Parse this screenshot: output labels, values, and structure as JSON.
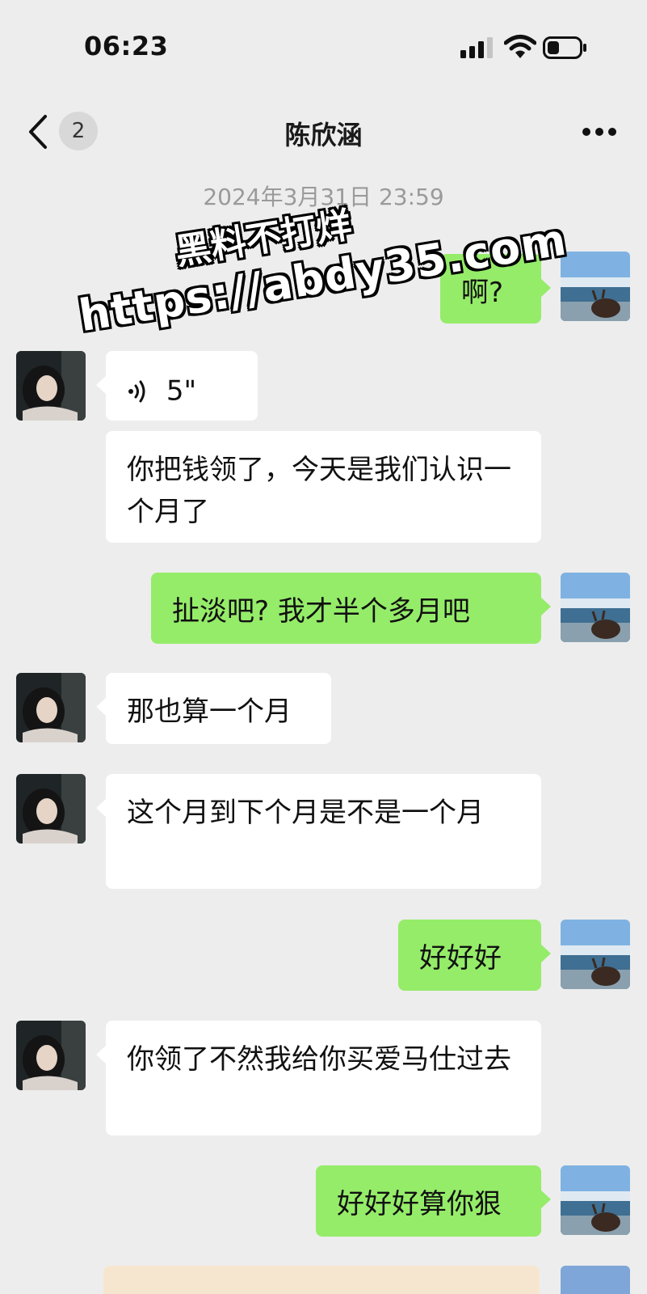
{
  "status_bar": {
    "time": "06:23",
    "signal_icon": "cellular-signal-icon",
    "wifi_icon": "wifi-icon",
    "battery_icon": "battery-icon"
  },
  "header": {
    "back_icon": "chevron-left-icon",
    "unread_count": "2",
    "title": "陈欣涵",
    "more_icon": "more-horizontal-icon"
  },
  "timestamp": "2024年3月31日 23:59",
  "watermark": {
    "line1": "黑料不打烊",
    "line2": "https://abdy35.com"
  },
  "messages": [
    {
      "side": "out",
      "text": "啊?"
    },
    {
      "side": "in",
      "type": "voice",
      "duration": "5\"",
      "icon": "voice-wave-icon"
    },
    {
      "side": "in",
      "text": "你把钱领了，今天是我们认识一个月了"
    },
    {
      "side": "out",
      "text": "扯淡吧?  我才半个多月吧"
    },
    {
      "side": "in",
      "text": "那也算一个月"
    },
    {
      "side": "in",
      "text": "这个月到下个月是不是一个月"
    },
    {
      "side": "out",
      "text": "好好好"
    },
    {
      "side": "in",
      "text": "你领了不然我给你买爱马仕过去"
    },
    {
      "side": "out",
      "text": "好好好算你狠"
    }
  ],
  "colors": {
    "background": "#ededed",
    "bubble_out": "#95ec69",
    "bubble_in": "#ffffff"
  }
}
